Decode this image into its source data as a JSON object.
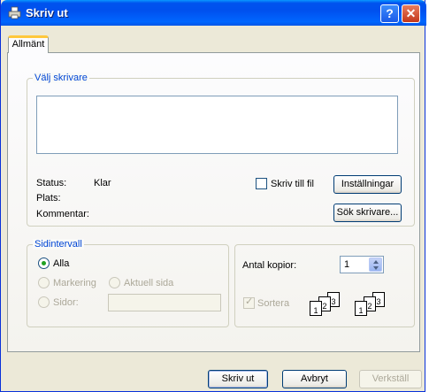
{
  "window": {
    "title": "Skriv ut",
    "help_icon": "question-mark",
    "close_icon": "x-mark"
  },
  "tabs": [
    {
      "label": "Allmänt",
      "active": true
    }
  ],
  "printer_group": {
    "legend": "Välj skrivare",
    "status_label": "Status:",
    "status_value": "Klar",
    "location_label": "Plats:",
    "comment_label": "Kommentar:",
    "print_to_file_label": "Skriv till fil",
    "print_to_file_checked": false,
    "preferences_button": "Inställningar",
    "find_printer_button": "Sök skrivare..."
  },
  "page_range_group": {
    "legend": "Sidintervall",
    "all_label": "Alla",
    "selection_label": "Markering",
    "current_page_label": "Aktuell sida",
    "pages_label": "Sidor:",
    "pages_value": "",
    "selected": "Alla"
  },
  "copies_group": {
    "copies_label": "Antal kopior:",
    "copies_value": "1",
    "collate_label": "Sortera",
    "collate_checked": true
  },
  "footer": {
    "print_button": "Skriv ut",
    "cancel_button": "Avbryt",
    "apply_button": "Verkställ"
  }
}
